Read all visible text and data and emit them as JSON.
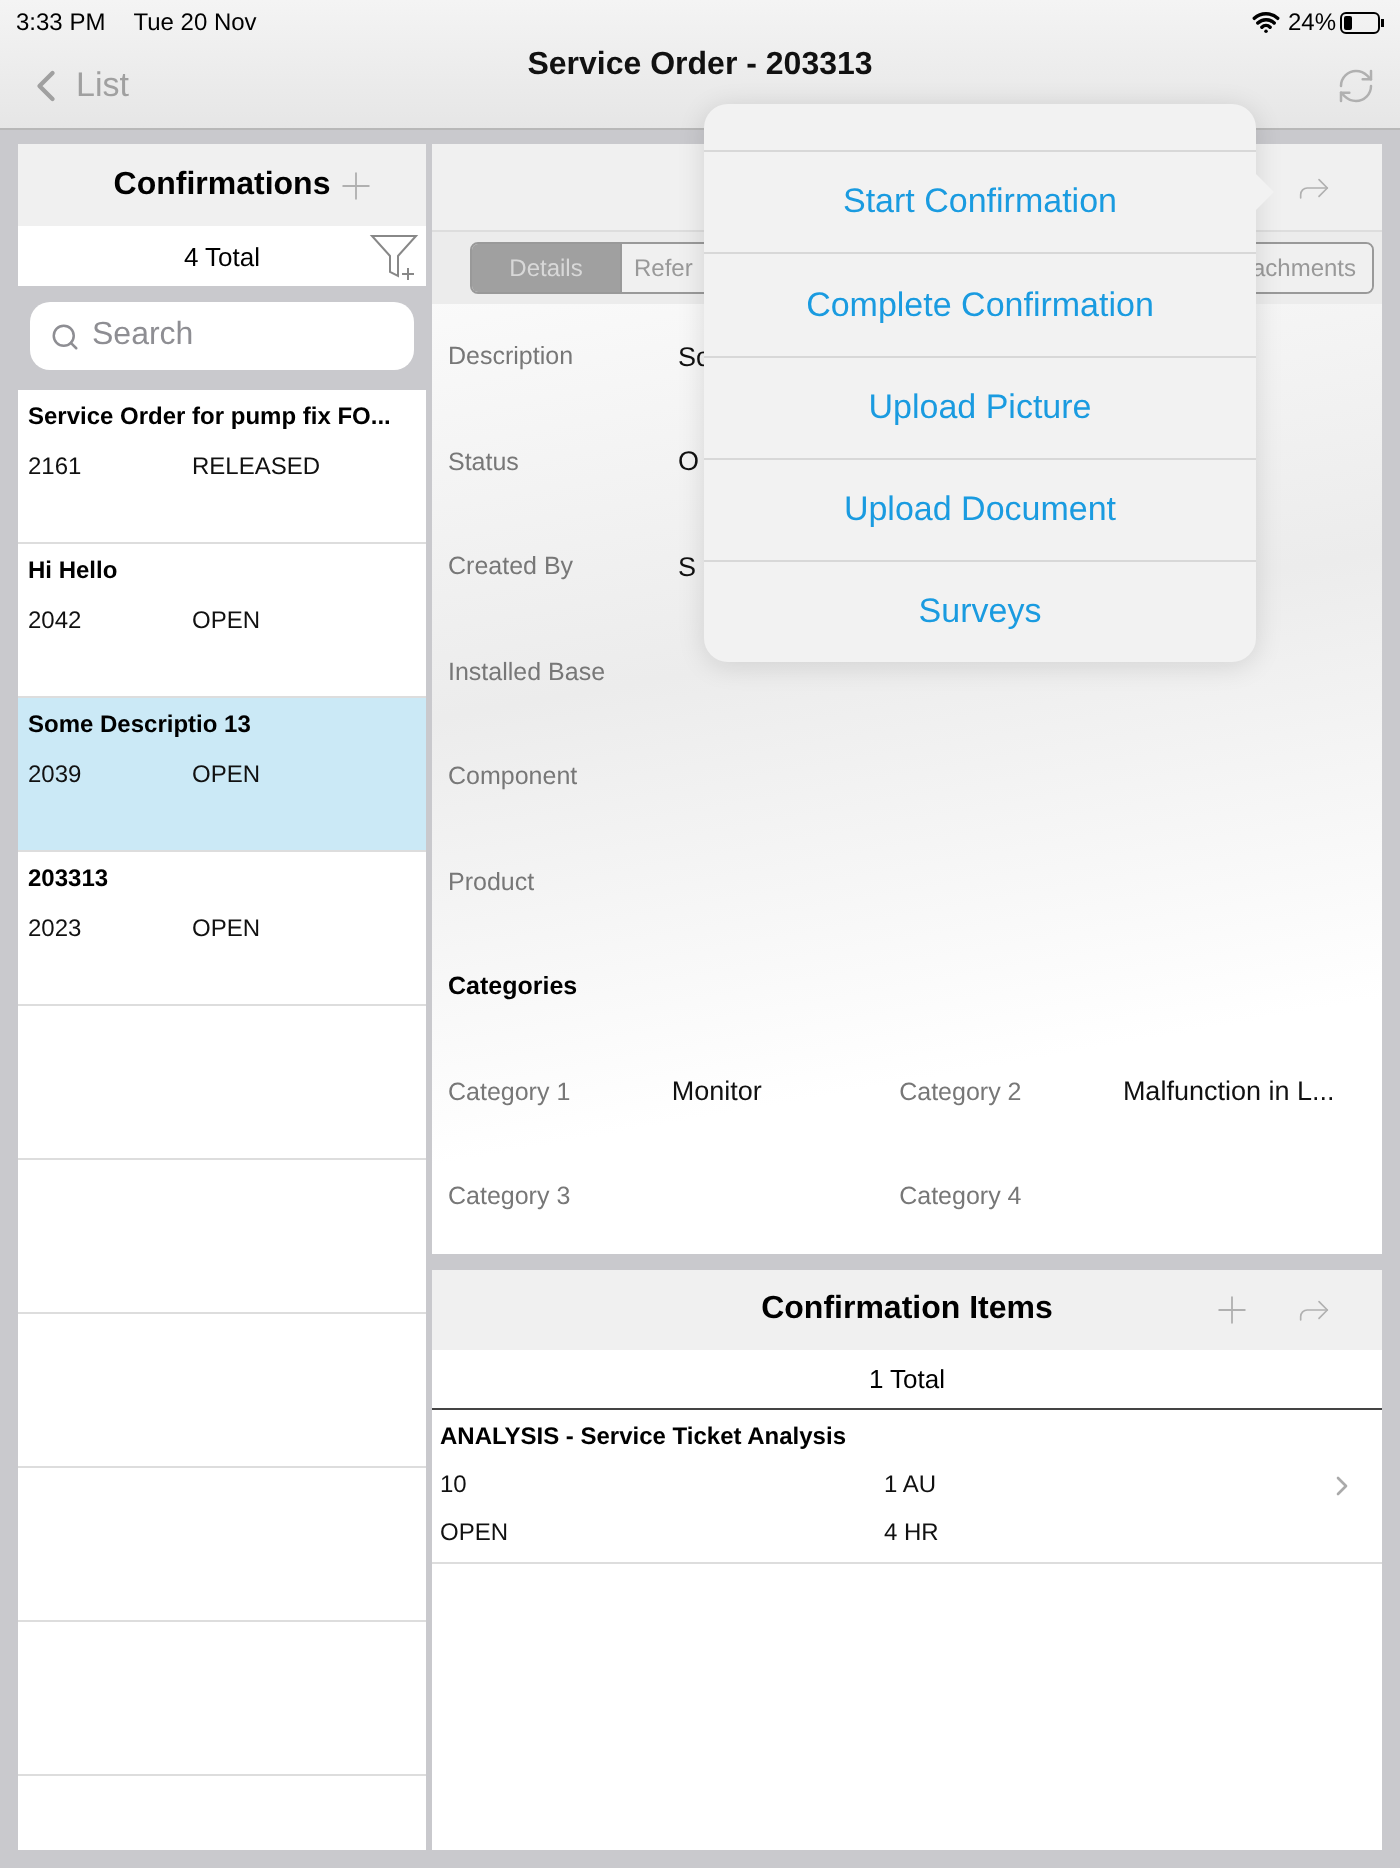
{
  "status_bar": {
    "time": "3:33 PM",
    "date": "Tue 20 Nov",
    "battery": "24%"
  },
  "nav": {
    "back": "List",
    "title": "Service Order - 203313"
  },
  "confirmations": {
    "title": "Confirmations",
    "total": "4 Total",
    "search": {
      "placeholder": "Search"
    },
    "items": [
      {
        "title": "Service Order for pump fix FO...",
        "number": "2161",
        "status": "RELEASED",
        "selected": false
      },
      {
        "title": "Hi Hello",
        "number": "2042",
        "status": "OPEN",
        "selected": false
      },
      {
        "title": "Some Descriptio 13",
        "number": "2039",
        "status": "OPEN",
        "selected": true
      },
      {
        "title": "203313",
        "number": "2023",
        "status": "OPEN",
        "selected": false
      }
    ]
  },
  "detail": {
    "tabs": [
      {
        "label": "Details",
        "selected": true
      },
      {
        "label": "Refer",
        "selected": false
      },
      {
        "label": "achments",
        "selected": false
      }
    ],
    "fields": [
      {
        "label": "Description",
        "value": "Sc"
      },
      {
        "label": "Status",
        "value": "O"
      },
      {
        "label": "Created By",
        "value": "S"
      },
      {
        "label": "Installed Base"
      },
      {
        "label": "Component"
      },
      {
        "label": "Product"
      }
    ],
    "categories_heading": "Categories",
    "categories": [
      {
        "label": "Category 1",
        "value": "Monitor"
      },
      {
        "label": "Category 2",
        "value": "Malfunction in L..."
      },
      {
        "label": "Category 3"
      },
      {
        "label": "Category 4"
      }
    ]
  },
  "menu": {
    "items": [
      "Start Confirmation",
      "Complete Confirmation",
      "Upload Picture",
      "Upload Document",
      "Surveys"
    ]
  },
  "items_panel": {
    "title": "Confirmation Items",
    "total": "1 Total",
    "rows": [
      {
        "title": "ANALYSIS - Service Ticket Analysis",
        "number": "10",
        "quantity": "1 AU",
        "status": "OPEN",
        "duration": "4 HR"
      }
    ]
  }
}
